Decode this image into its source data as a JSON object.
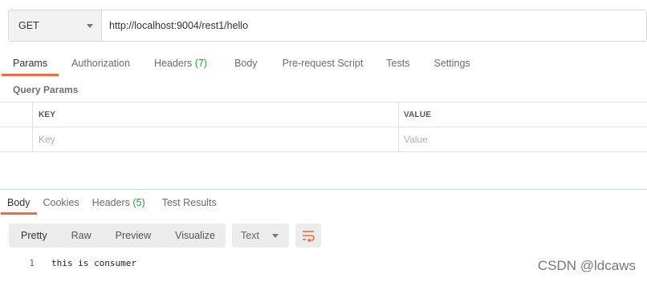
{
  "request": {
    "method": "GET",
    "url": "http://localhost:9004/rest1/hello"
  },
  "request_tabs": [
    {
      "label": "Params",
      "active": true
    },
    {
      "label": "Authorization"
    },
    {
      "label": "Headers",
      "count": "(7)"
    },
    {
      "label": "Body"
    },
    {
      "label": "Pre-request Script"
    },
    {
      "label": "Tests"
    },
    {
      "label": "Settings"
    }
  ],
  "query_params": {
    "title": "Query Params",
    "columns": [
      "KEY",
      "VALUE"
    ],
    "placeholders": {
      "key": "Key",
      "value": "Value"
    }
  },
  "response_tabs": [
    {
      "label": "Body",
      "active": true
    },
    {
      "label": "Cookies"
    },
    {
      "label": "Headers",
      "count": "(5)"
    },
    {
      "label": "Test Results"
    }
  ],
  "response_toolbar": {
    "view_modes": [
      "Pretty",
      "Raw",
      "Preview",
      "Visualize"
    ],
    "active_view": "Pretty",
    "format": "Text",
    "wrap_icon": "wrap-lines-icon"
  },
  "response_body": {
    "lines": [
      {
        "num": "1",
        "text": "this is consumer"
      }
    ]
  },
  "watermark": "CSDN @ldcaws",
  "colors": {
    "accent": "#f26b3a",
    "count_green": "#2a9d3c"
  }
}
